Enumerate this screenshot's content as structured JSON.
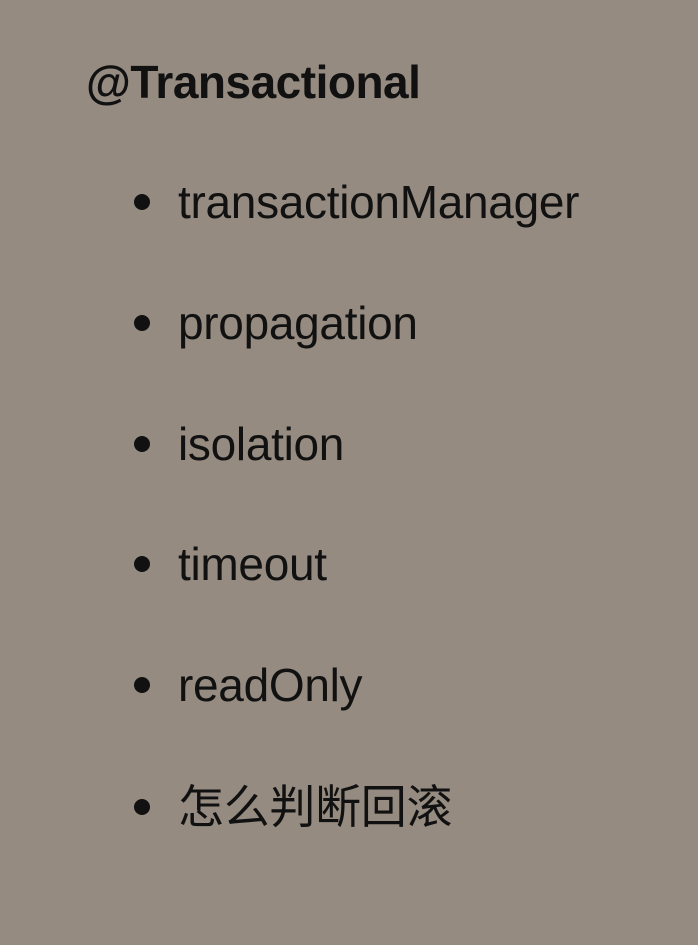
{
  "slide": {
    "title": "@Transactional",
    "bullets": [
      {
        "text": "transactionManager"
      },
      {
        "text": "propagation"
      },
      {
        "text": "isolation"
      },
      {
        "text": "timeout"
      },
      {
        "text": "readOnly"
      },
      {
        "text": "怎么判断回滚"
      }
    ]
  },
  "colors": {
    "background": "#958b81",
    "text": "#111111"
  }
}
